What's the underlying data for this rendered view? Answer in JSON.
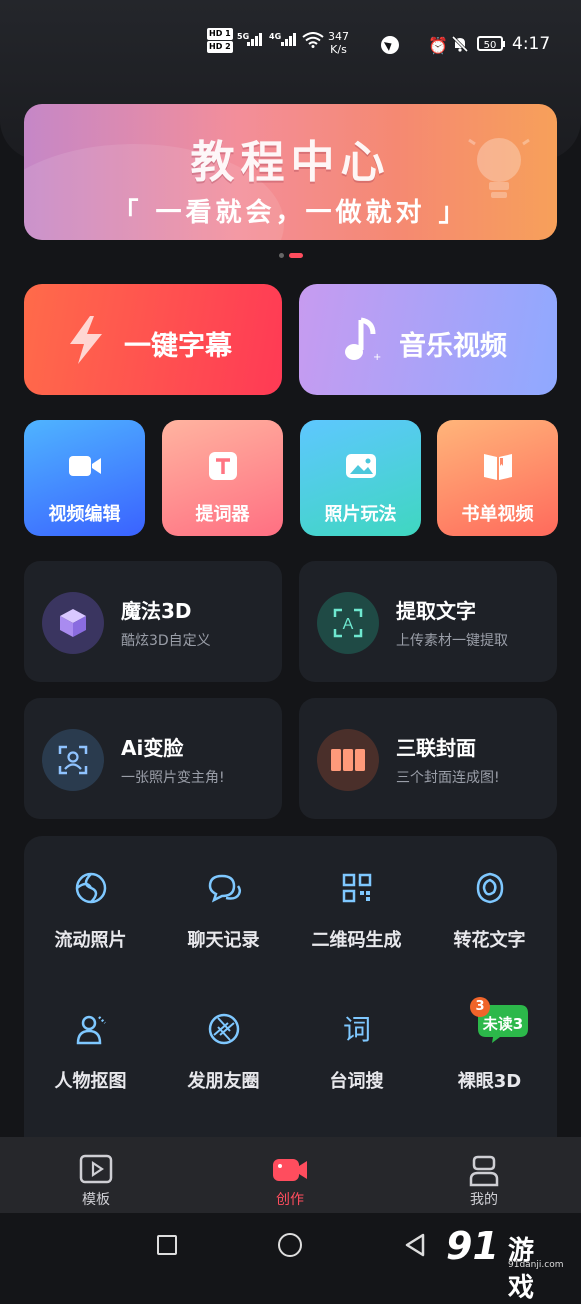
{
  "status_bar": {
    "sim1": "HD 1",
    "sim2": "HD 2",
    "net1": "5G",
    "net2": "4G",
    "speed_value": "347",
    "speed_unit": "K/s",
    "battery": "50",
    "time": "4:17"
  },
  "banner": {
    "title": "教程中心",
    "subtitle": "「 一看就会，一做就对 」"
  },
  "big_buttons": [
    {
      "label": "一键字幕",
      "icon": "lightning-icon"
    },
    {
      "label": "音乐视频",
      "icon": "music-note-icon"
    }
  ],
  "features": [
    {
      "label": "视频编辑",
      "icon": "video-camera-icon"
    },
    {
      "label": "提词器",
      "icon": "teleprompter-t-icon"
    },
    {
      "label": "照片玩法",
      "icon": "photo-icon"
    },
    {
      "label": "书单视频",
      "icon": "book-icon"
    }
  ],
  "cards": [
    {
      "title": "魔法3D",
      "subtitle": "酷炫3D自定义",
      "icon": "cube-icon"
    },
    {
      "title": "提取文字",
      "subtitle": "上传素材一键提取",
      "icon": "text-scan-icon"
    },
    {
      "title": "Ai变脸",
      "subtitle": "一张照片变主角!",
      "icon": "face-scan-icon"
    },
    {
      "title": "三联封面",
      "subtitle": "三个封面连成图!",
      "icon": "triple-panel-icon"
    }
  ],
  "tools": [
    {
      "label": "流动照片",
      "icon": "aperture-swirl-icon"
    },
    {
      "label": "聊天记录",
      "icon": "chat-bubbles-icon"
    },
    {
      "label": "二维码生成",
      "icon": "qr-code-icon"
    },
    {
      "label": "转花文字",
      "icon": "flower-swirl-icon"
    },
    {
      "label": "人物抠图",
      "icon": "person-cutout-icon"
    },
    {
      "label": "发朋友圈",
      "icon": "moments-shutter-icon"
    },
    {
      "label": "台词搜",
      "icon": "ci-character-icon"
    },
    {
      "label": "裸眼3D",
      "icon": "unread-bubble-icon"
    }
  ],
  "unread_badge": {
    "count": "3",
    "text": "未读3"
  },
  "tabs": [
    {
      "label": "模板",
      "icon": "play-template-icon"
    },
    {
      "label": "创作",
      "icon": "camera-create-icon"
    },
    {
      "label": "我的",
      "icon": "profile-icon"
    }
  ],
  "active_tab_color": "#ff4d5e",
  "watermark": {
    "number": "91",
    "text": "游戏",
    "url": "91danji.com"
  }
}
